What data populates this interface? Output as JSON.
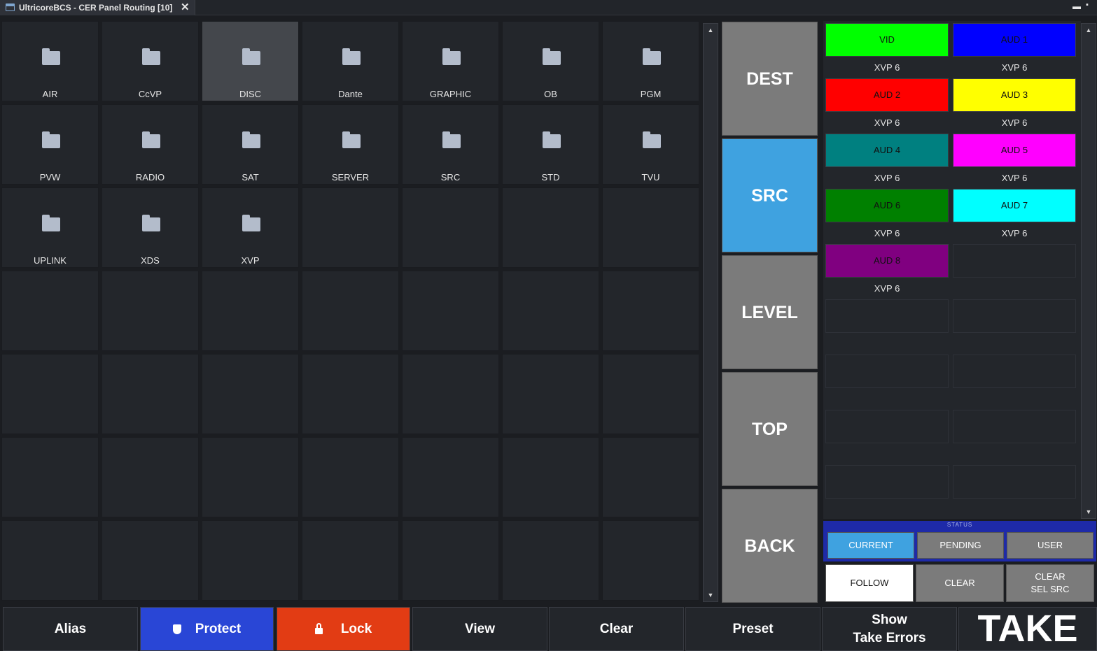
{
  "window": {
    "tab_title": "UltricoreBCS - CER Panel Routing [10]",
    "close_glyph": "✕",
    "min_glyph": "▬",
    "max_glyph": "▪"
  },
  "folders": [
    {
      "label": "AIR",
      "selected": false
    },
    {
      "label": "CcVP",
      "selected": false
    },
    {
      "label": "DISC",
      "selected": true
    },
    {
      "label": "Dante",
      "selected": false
    },
    {
      "label": "GRAPHIC",
      "selected": false
    },
    {
      "label": "OB",
      "selected": false
    },
    {
      "label": "PGM",
      "selected": false
    },
    {
      "label": "PVW",
      "selected": false
    },
    {
      "label": "RADIO",
      "selected": false
    },
    {
      "label": "SAT",
      "selected": false
    },
    {
      "label": "SERVER",
      "selected": false
    },
    {
      "label": "SRC",
      "selected": false
    },
    {
      "label": "STD",
      "selected": false
    },
    {
      "label": "TVU",
      "selected": false
    },
    {
      "label": "UPLINK",
      "selected": false
    },
    {
      "label": "XDS",
      "selected": false
    },
    {
      "label": "XVP",
      "selected": false
    }
  ],
  "modes": {
    "dest": "DEST",
    "src": "SRC",
    "level": "LEVEL",
    "top": "TOP",
    "back": "BACK",
    "active": "SRC"
  },
  "levels": [
    {
      "name": "VID",
      "source": "XVP 6",
      "color": "#00ff00"
    },
    {
      "name": "AUD 1",
      "source": "XVP 6",
      "color": "#0000ff"
    },
    {
      "name": "AUD 2",
      "source": "XVP 6",
      "color": "#ff0000"
    },
    {
      "name": "AUD 3",
      "source": "XVP 6",
      "color": "#ffff00"
    },
    {
      "name": "AUD 4",
      "source": "XVP 6",
      "color": "#008080"
    },
    {
      "name": "AUD 5",
      "source": "XVP 6",
      "color": "#ff00ff"
    },
    {
      "name": "AUD 6",
      "source": "XVP 6",
      "color": "#008000"
    },
    {
      "name": "AUD 7",
      "source": "XVP 6",
      "color": "#00ffff"
    },
    {
      "name": "AUD 8",
      "source": "XVP 6",
      "color": "#800080"
    }
  ],
  "status": {
    "title": "STATUS",
    "current": "CURRENT",
    "pending": "PENDING",
    "user": "USER",
    "active": "CURRENT"
  },
  "actions": {
    "follow": "FOLLOW",
    "clear": "CLEAR",
    "clear_sel_src_line1": "CLEAR",
    "clear_sel_src_line2": "SEL SRC"
  },
  "bottom": {
    "alias": "Alias",
    "protect": "Protect",
    "lock": "Lock",
    "view": "View",
    "clear": "Clear",
    "preset": "Preset",
    "show_line1": "Show",
    "show_line2": "Take Errors",
    "take": "TAKE"
  },
  "colors": {
    "accent_blue": "#3fa2e0",
    "protect_blue": "#2946d6",
    "lock_red": "#e23c14",
    "status_navy": "#1e2aa8"
  },
  "icons": {
    "up": "▲",
    "down": "▼"
  }
}
